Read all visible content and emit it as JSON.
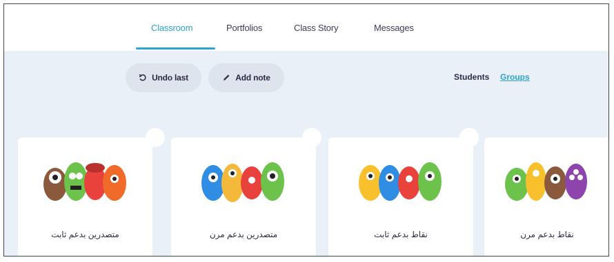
{
  "nav": {
    "tabs": [
      {
        "label": "Classroom",
        "active": true
      },
      {
        "label": "Portfolios",
        "active": false
      },
      {
        "label": "Class Story",
        "active": false
      },
      {
        "label": "Messages",
        "active": false
      }
    ]
  },
  "toolbar": {
    "undo_label": "Undo last",
    "add_note_label": "Add note",
    "undo_icon": "undo-icon",
    "pencil_icon": "pencil-icon"
  },
  "view_toggle": {
    "students": "Students",
    "groups": "Groups",
    "active": "groups"
  },
  "groups": [
    {
      "name": "متصدرين بدعم ثابت"
    },
    {
      "name": "متصدرين بدعم مرن"
    },
    {
      "name": "نقاط بدعم ثابت"
    },
    {
      "name": "نقاط بدعم مرن"
    }
  ],
  "colors": {
    "accent": "#2ba3d4",
    "background": "#eaf0f8",
    "pill": "#dde4ee",
    "text": "#2c2a45"
  }
}
